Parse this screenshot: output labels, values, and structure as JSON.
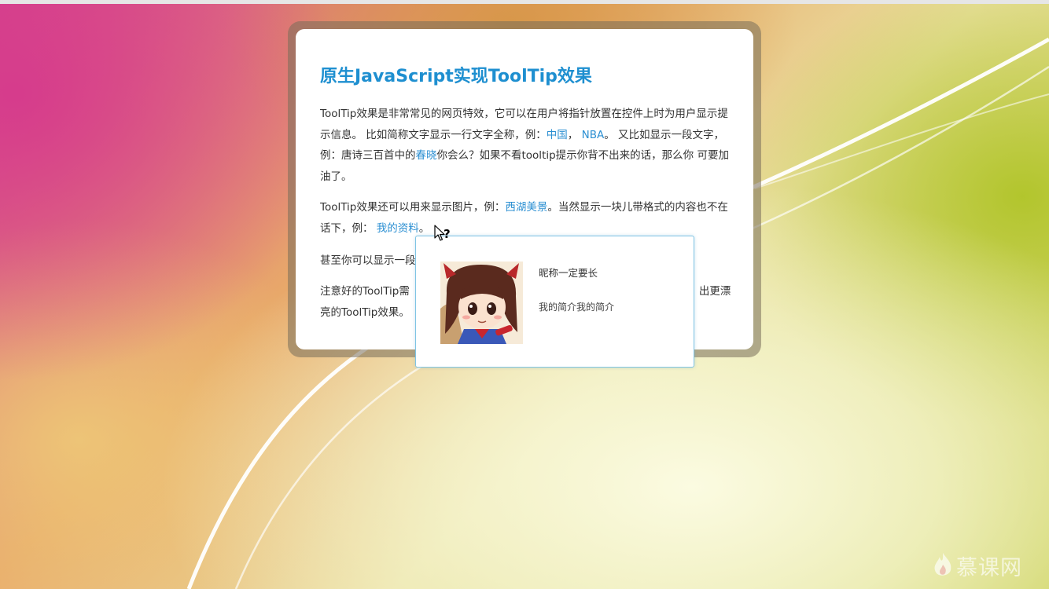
{
  "page": {
    "title": "原生JavaScript实现ToolTip效果"
  },
  "paragraphs": {
    "p1": {
      "t1": "ToolTip效果是非常常见的网页特效，它可以在用户将指针放置在控件上时为用户显示提示信息。 比如简称文字显示一行文字全称，例：",
      "link_china": "中国",
      "sep": "，  ",
      "link_nba": "NBA",
      "t2": "。 又比如显示一段文字，例：唐诗三百首中的",
      "link_chunxiao": "春晓",
      "t3": "你会么？如果不看tooltip提示你背不出来的话，那么你 可要加油了。"
    },
    "p2": {
      "t1": "ToolTip效果还可以用来显示图片，例：",
      "link_xihu": "西湖美景",
      "t2": "。当然显示一块儿带格式的内容也不在话下，例： ",
      "link_profile": "我的资料",
      "t3": "。"
    },
    "p3": {
      "t1": "甚至你可以显示一段"
    },
    "p4": {
      "t1": "注意好的ToolTip需",
      "t2": "出更漂",
      "t3": "亮的ToolTip效果。"
    }
  },
  "tooltip": {
    "nickname": "昵称一定要长",
    "intro": "我的简介我的简介"
  },
  "watermark": {
    "text": "慕课网"
  },
  "icons": {
    "cursor": "help-cursor-icon",
    "avatar": "avatar-image",
    "brand": "flame-logo-icon"
  },
  "colors": {
    "title": "#1e8fd0",
    "link": "#2b8fd2",
    "tooltip_border": "#7fc4e4"
  }
}
